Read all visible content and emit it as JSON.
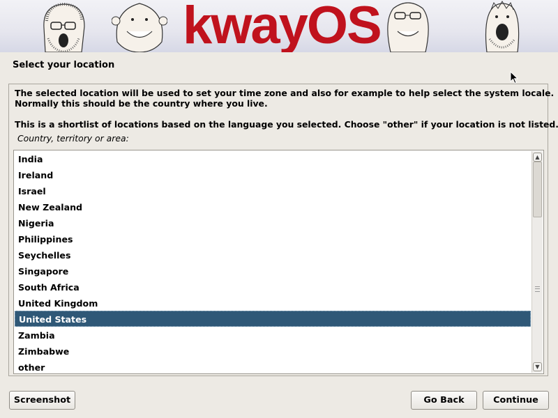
{
  "banner": {
    "logo_text": "kwayOS",
    "logo_color": "#c0121d"
  },
  "page_title": "Select your location",
  "description": {
    "line1": "The selected location will be used to set your time zone and also for example to help select the system locale.",
    "line2": "Normally this should be the country where you live.",
    "line3": "This is a shortlist of locations based on the language you selected. Choose \"other\" if your location is not listed."
  },
  "field_label": "Country, territory or area:",
  "countries": [
    "India",
    "Ireland",
    "Israel",
    "New Zealand",
    "Nigeria",
    "Philippines",
    "Seychelles",
    "Singapore",
    "South Africa",
    "United Kingdom",
    "United States",
    "Zambia",
    "Zimbabwe",
    "other"
  ],
  "selected_country": "United States",
  "colors": {
    "selection": "#2f5877",
    "background": "#edeae4"
  },
  "buttons": {
    "screenshot": "Screenshot",
    "go_back": "Go Back",
    "continue": "Continue"
  },
  "icons": {
    "scroll_up": "arrow-up-icon",
    "scroll_down": "arrow-down-icon",
    "pointer": "mouse-pointer-icon"
  }
}
